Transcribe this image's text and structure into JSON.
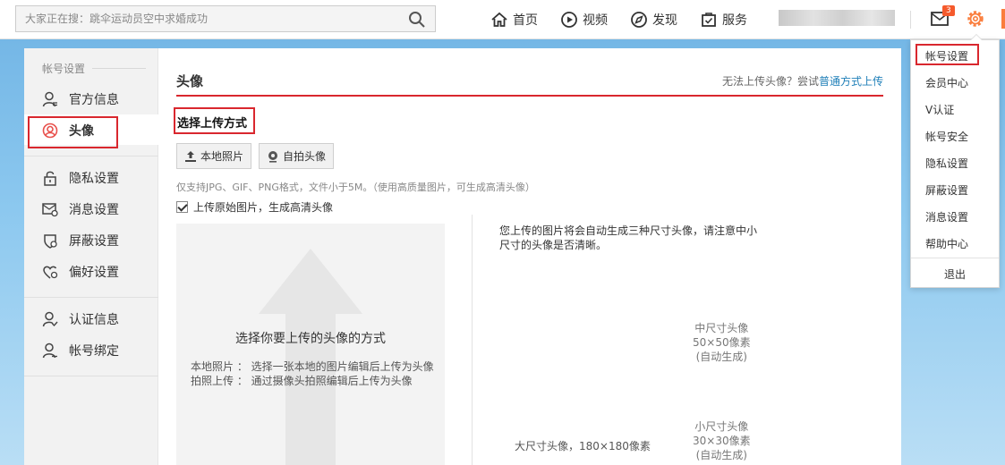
{
  "search": {
    "placeholder": "大家正在搜：跳伞运动员空中求婚成功"
  },
  "nav": [
    {
      "label": "首页",
      "icon": "home-icon"
    },
    {
      "label": "视频",
      "icon": "video-icon"
    },
    {
      "label": "发现",
      "icon": "compass-icon"
    },
    {
      "label": "服务",
      "icon": "service-icon"
    }
  ],
  "header": {
    "mail_badge": "3",
    "accent_color": "#fa7d3c"
  },
  "sidebar": {
    "section_title": "帐号设置",
    "items": [
      {
        "label": "官方信息",
        "icon": "user-info-icon"
      },
      {
        "label": "头像",
        "icon": "avatar-icon"
      },
      {
        "label": "隐私设置",
        "icon": "lock-icon"
      },
      {
        "label": "消息设置",
        "icon": "message-icon"
      },
      {
        "label": "屏蔽设置",
        "icon": "shield-icon"
      },
      {
        "label": "偏好设置",
        "icon": "heart-gear-icon"
      },
      {
        "label": "认证信息",
        "icon": "verify-icon"
      },
      {
        "label": "帐号绑定",
        "icon": "bind-icon"
      }
    ],
    "active_index": 1
  },
  "main": {
    "title": "头像",
    "hint_prefix": "无法上传头像？尝试",
    "hint_link": "普通方式上传",
    "method_title": "选择上传方式",
    "buttons": {
      "local_photo": "本地照片",
      "selfie": "自拍头像"
    },
    "formats_note": "仅支持JPG、GIF、PNG格式，文件小于5M。（使用高质量图片，可生成高清头像）",
    "checkbox_label": "上传原始图片，生成高清头像",
    "checkbox_checked": true,
    "upload": {
      "title": "选择你要上传的头像的方式",
      "desc_local": "本地照片 ：  选择一张本地的图片编辑后上传为头像",
      "desc_camera": "拍照上传 ：  通过摄像头拍照编辑后上传为头像"
    },
    "preview": {
      "note": "您上传的图片将会自动生成三种尺寸头像，请注意中小尺寸的头像是否清晰。",
      "medium": [
        "中尺寸头像",
        "50×50像素",
        "(自动生成)"
      ],
      "small": [
        "小尺寸头像",
        "30×30像素",
        "(自动生成)"
      ],
      "large": "大尺寸头像，180×180像素"
    }
  },
  "dropdown": {
    "items": [
      "帐号设置",
      "会员中心",
      "V认证",
      "帐号安全",
      "隐私设置",
      "屏蔽设置",
      "消息设置",
      "帮助中心"
    ],
    "logout": "退出"
  }
}
